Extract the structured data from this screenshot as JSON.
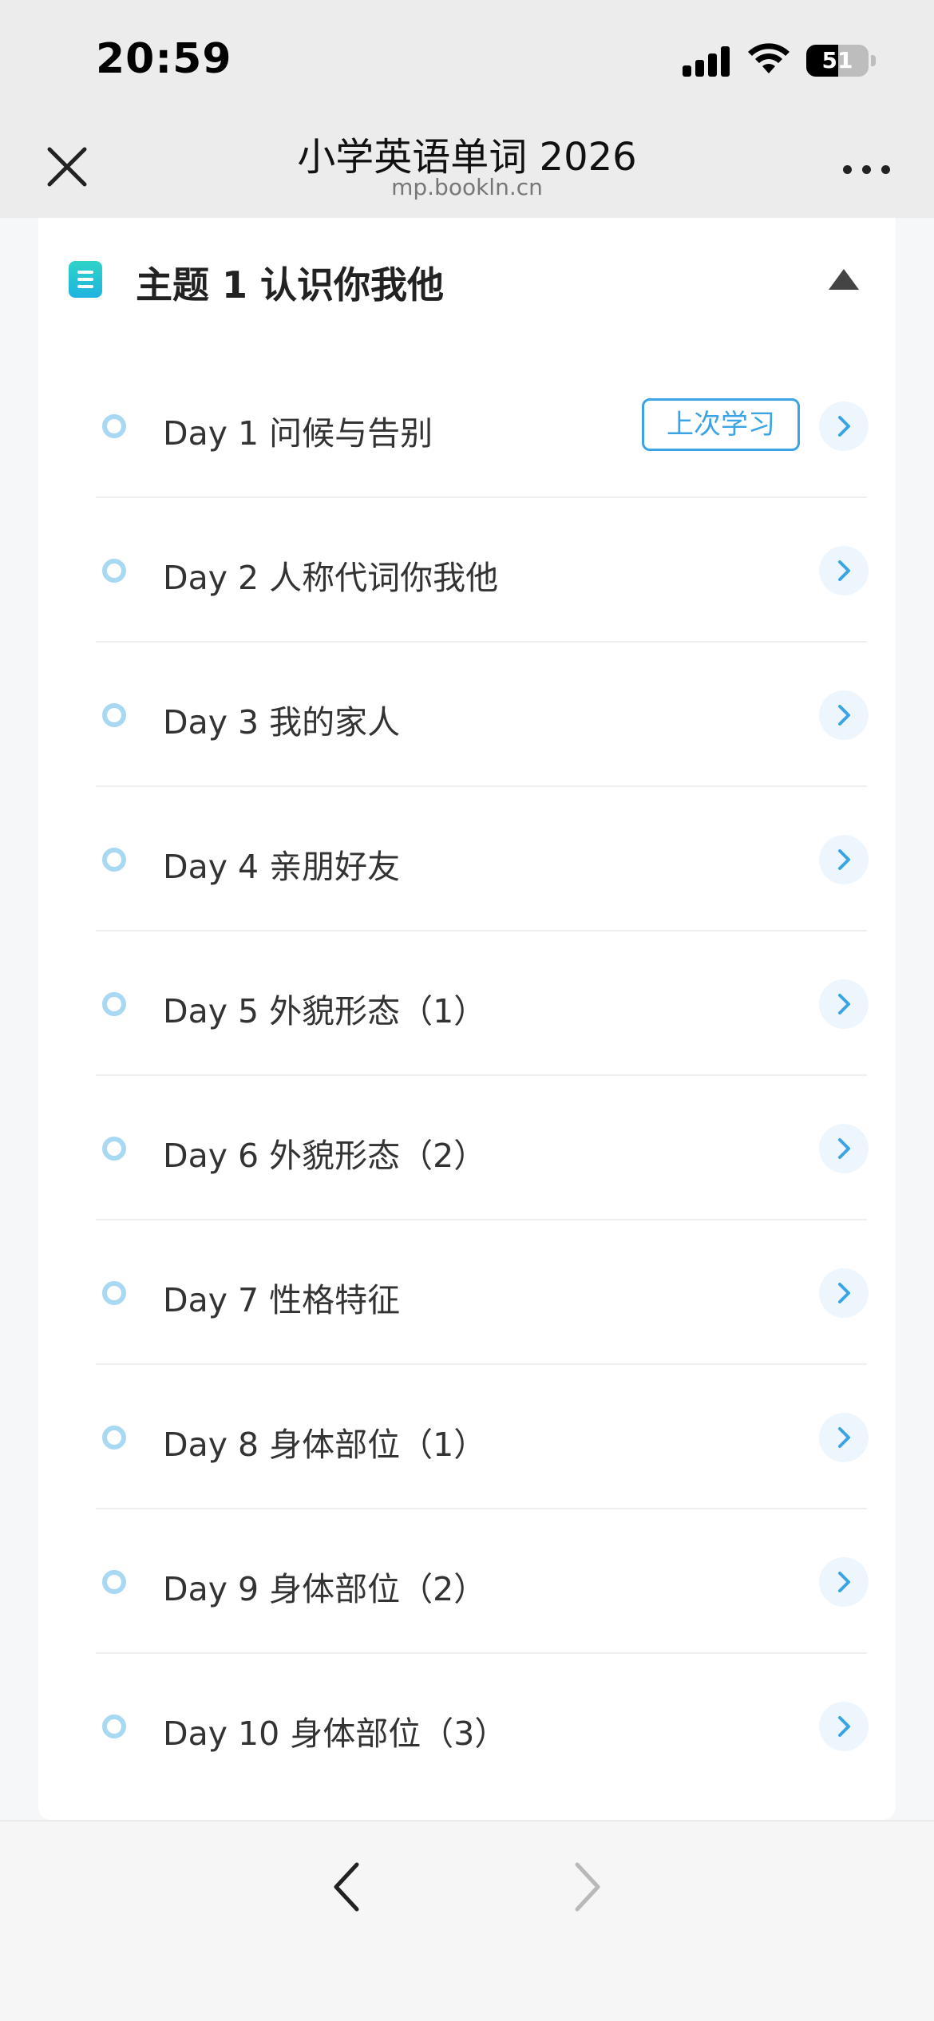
{
  "status_bar": {
    "time": "20:59",
    "battery": "51",
    "battery_level": 0.51
  },
  "nav": {
    "title": "小学英语单词 2026",
    "subtitle": "mp.bookln.cn",
    "close_icon": "close-icon",
    "more_icon": "more-icon"
  },
  "section": {
    "title": "主题 1 认识你我他",
    "icon": "document-icon",
    "expanded": true,
    "lessons": [
      {
        "label": "Day 1 问候与告别",
        "badge": "上次学习"
      },
      {
        "label": "Day 2 人称代词你我他"
      },
      {
        "label": "Day 3 我的家人"
      },
      {
        "label": "Day 4 亲朋好友"
      },
      {
        "label": "Day 5 外貌形态（1）"
      },
      {
        "label": "Day 6 外貌形态（2）"
      },
      {
        "label": "Day 7 性格特征"
      },
      {
        "label": "Day 8 身体部位（1）"
      },
      {
        "label": "Day 9 身体部位（2）"
      },
      {
        "label": "Day 10 身体部位（3）"
      }
    ]
  },
  "colors": {
    "accent": "#3ba4e4",
    "dot": "#a9d8f3",
    "chevron_bg": "#eef6fd"
  },
  "toolbar": {
    "back_icon": "chevron-left-icon",
    "forward_icon": "chevron-right-icon",
    "forward_enabled": false
  }
}
